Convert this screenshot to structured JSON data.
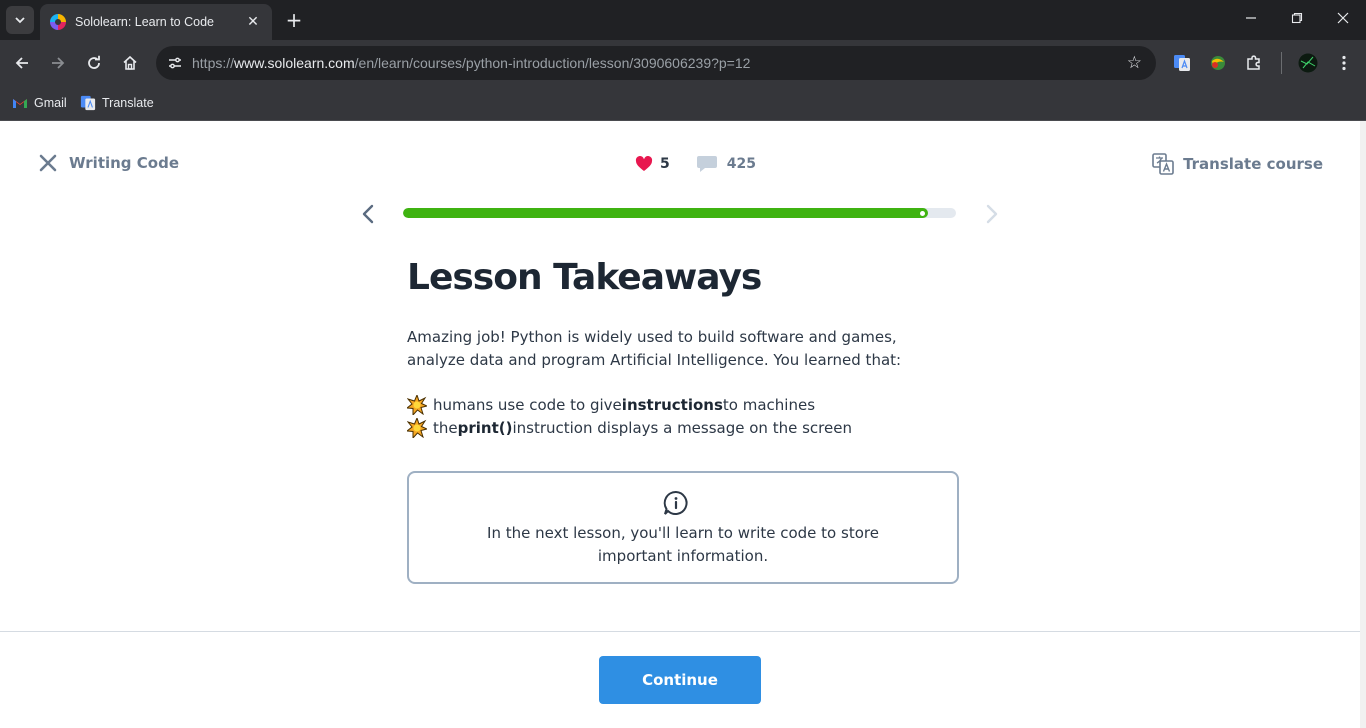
{
  "browser": {
    "tab_title": "Sololearn: Learn to Code",
    "url_scheme": "https://",
    "url_host": "www.sololearn.com",
    "url_path": "/en/learn/courses/python-introduction/lesson/3090606239?p=12",
    "bookmarks": [
      {
        "label": "Gmail",
        "icon": "gmail-icon"
      },
      {
        "label": "Translate",
        "icon": "translate-icon"
      }
    ]
  },
  "lesson": {
    "name": "Writing Code",
    "hearts": "5",
    "comments": "425",
    "translate_label": "Translate course",
    "progress": 0.95
  },
  "content": {
    "heading": "Lesson Takeaways",
    "intro": "Amazing job! Python is widely used to build software and games, analyze data and program Artificial Intelligence. You learned that:",
    "bullets": [
      {
        "before": "humans use code to give ",
        "bold": "instructions",
        "after": " to machines"
      },
      {
        "before": "the ",
        "bold": "print()",
        "after": " instruction displays a message on the screen"
      }
    ],
    "info_text": "In the next lesson, you'll learn to write code to store important information."
  },
  "footer": {
    "continue_label": "Continue"
  },
  "colors": {
    "progress": "#3fb311",
    "heart": "#e8174f",
    "primary_button": "#2f8fe3"
  }
}
